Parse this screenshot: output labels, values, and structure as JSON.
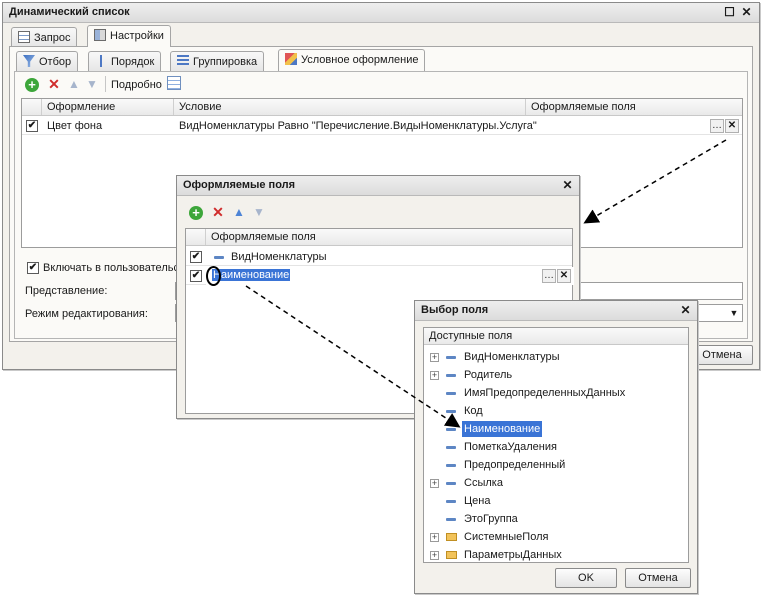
{
  "main": {
    "title": "Динамический список",
    "tabs": [
      "Запрос",
      "Настройки"
    ],
    "subtabs": [
      "Отбор",
      "Порядок",
      "Группировка",
      "Условное оформление"
    ],
    "toolbar": {
      "details": "Подробно"
    },
    "columns": {
      "style": "Оформление",
      "condition": "Условие",
      "fields": "Оформляемые поля"
    },
    "row": {
      "style": "Цвет фона",
      "condition": "ВидНоменклатуры Равно \"Перечисление.ВидыНоменклатуры.Услуга\"",
      "checked": true
    },
    "include_label": "Включать в пользовательски",
    "presentation_label": "Представление:",
    "edit_mode_label": "Режим редактирования:",
    "cancel_button": "Отмена"
  },
  "fields_dialog": {
    "title": "Оформляемые поля",
    "column": "Оформляемые поля",
    "rows": [
      {
        "text": "ВидНоменклатуры",
        "checked": true
      },
      {
        "text": "Наименование",
        "checked": true,
        "selected": true
      }
    ]
  },
  "choose_dialog": {
    "title": "Выбор поля",
    "header": "Доступные поля",
    "items": [
      {
        "text": "ВидНоменклатуры",
        "expandable": true,
        "icon": "field-icon"
      },
      {
        "text": "Родитель",
        "expandable": true,
        "icon": "field-icon"
      },
      {
        "text": "ИмяПредопределенныхДанных",
        "expandable": false,
        "icon": "field-icon"
      },
      {
        "text": "Код",
        "expandable": false,
        "icon": "field-icon"
      },
      {
        "text": "Наименование",
        "expandable": false,
        "icon": "field-icon",
        "selected": true
      },
      {
        "text": "ПометкаУдаления",
        "expandable": false,
        "icon": "field-icon"
      },
      {
        "text": "Предопределенный",
        "expandable": false,
        "icon": "field-icon"
      },
      {
        "text": "Ссылка",
        "expandable": true,
        "icon": "field-icon"
      },
      {
        "text": "Цена",
        "expandable": false,
        "icon": "field-icon"
      },
      {
        "text": "ЭтоГруппа",
        "expandable": false,
        "icon": "field-icon"
      },
      {
        "text": "СистемныеПоля",
        "expandable": true,
        "icon": "folder-icon"
      },
      {
        "text": "ПараметрыДанных",
        "expandable": true,
        "icon": "folder-icon"
      }
    ],
    "ok_button": "OK",
    "cancel_button": "Отмена"
  },
  "colors": {
    "selection": "#3a74d6",
    "arrow": "#000000"
  }
}
